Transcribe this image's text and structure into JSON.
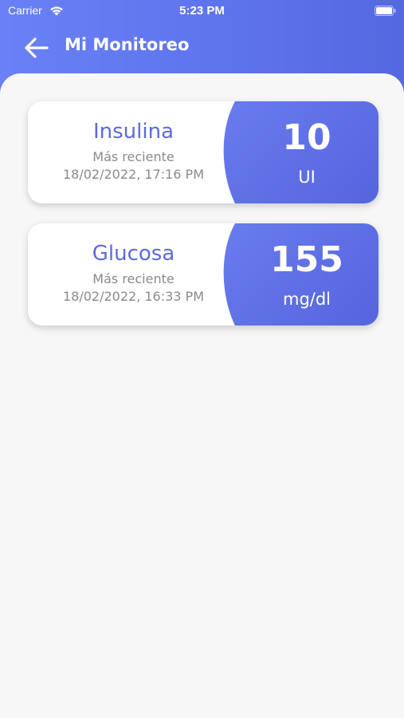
{
  "status_bar": {
    "carrier": "Carrier",
    "time": "5:23 PM"
  },
  "header": {
    "title": "Mi Monitoreo",
    "back_icon": "arrow-left-icon"
  },
  "colors": {
    "accent": "#5b6be0",
    "header": "#6a80f5",
    "background": "#f7f7f8"
  },
  "cards": [
    {
      "name": "Insulina",
      "subtitle": "Más reciente",
      "date": "18/02/2022, 17:16 PM",
      "value": "10",
      "unit": "UI"
    },
    {
      "name": "Glucosa",
      "subtitle": "Más reciente",
      "date": "18/02/2022, 16:33 PM",
      "value": "155",
      "unit": "mg/dl"
    }
  ]
}
